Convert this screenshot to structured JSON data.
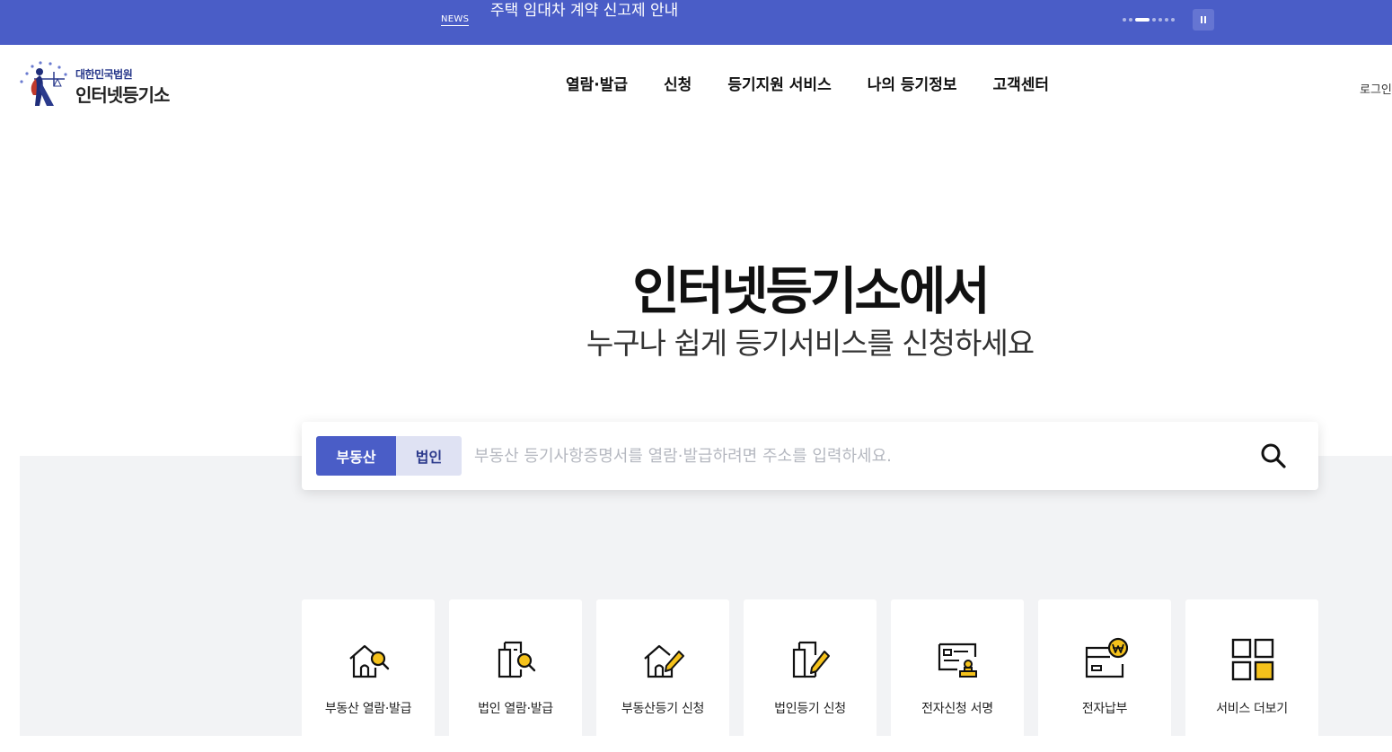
{
  "news": {
    "tag": "NEWS",
    "title": "주택 임대차 계약 신고제 안내",
    "pause_icon": "pause-icon"
  },
  "header": {
    "logo_small": "대한민국법원",
    "logo_big": "인터넷등기소",
    "nav": [
      {
        "label": "열람·발급"
      },
      {
        "label": "신청"
      },
      {
        "label": "등기지원 서비스"
      },
      {
        "label": "나의 등기정보"
      },
      {
        "label": "고객센터"
      }
    ],
    "login": "로그인"
  },
  "hero": {
    "title": "인터넷등기소에서",
    "subtitle": "누구나 쉽게 등기서비스를 신청하세요"
  },
  "search": {
    "tabs": [
      {
        "label": "부동산",
        "active": true
      },
      {
        "label": "법인",
        "active": false
      }
    ],
    "placeholder": "부동산 등기사항증명서를 열람·발급하려면 주소를 입력하세요.",
    "value": "",
    "icon": "search-icon"
  },
  "services": [
    {
      "label": "부동산 열람·발급",
      "icon": "house-search-icon"
    },
    {
      "label": "법인 열람·발급",
      "icon": "building-search-icon"
    },
    {
      "label": "부동산등기 신청",
      "icon": "house-pencil-icon"
    },
    {
      "label": "법인등기 신청",
      "icon": "building-pencil-icon"
    },
    {
      "label": "전자신청 서명",
      "icon": "document-stamp-icon"
    },
    {
      "label": "전자납부",
      "icon": "card-won-icon"
    },
    {
      "label": "서비스 더보기",
      "icon": "grid-icon"
    }
  ],
  "colors": {
    "brand": "#4a5dc7",
    "accent": "#f5c21b",
    "tab_inactive": "#dfe2f3",
    "background_gray": "#f2f3f5"
  }
}
